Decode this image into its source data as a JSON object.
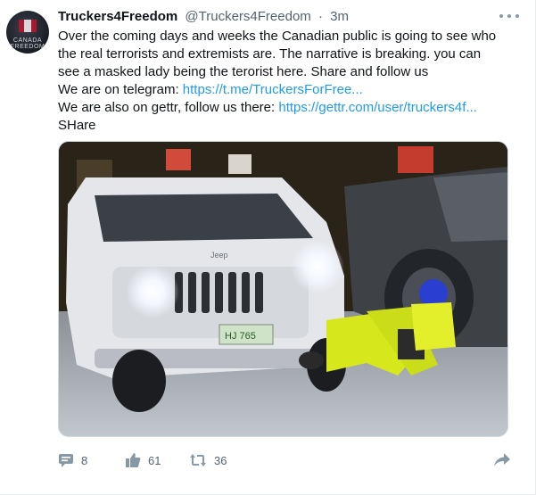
{
  "tweet": {
    "author_name": "Truckers4Freedom",
    "author_handle": "@Truckers4Freedom",
    "separator": "·",
    "time": "3m",
    "avatar_text": "CANADA FREEDOM",
    "text_lines": [
      {
        "plain": "Over the coming days and weeks the Canadian public is going to see who",
        "link": ""
      },
      {
        "plain": "the real terrorists and extremists are. The narrative is breaking. you can",
        "link": ""
      },
      {
        "plain": "see a masked lady being the terorist here. Share and follow us",
        "link": ""
      },
      {
        "plain": "We are on telegram: ",
        "link": "https://t.me/TruckersForFree..."
      },
      {
        "plain": "We are also on gettr, follow us there: ",
        "link": "https://gettr.com/user/truckers4f..."
      },
      {
        "plain": "SHare",
        "link": ""
      }
    ],
    "media": {
      "plate_text": "HJ 765",
      "jeep_badge": "Jeep"
    },
    "actions": {
      "reply_count": "8",
      "like_count": "61",
      "retweet_count": "36"
    }
  },
  "colors": {
    "link": "#1d9bf0",
    "icon": "#8899a6",
    "muted_text": "#536471"
  },
  "icons": [
    "more-icon",
    "reply-icon",
    "like-icon",
    "retweet-icon",
    "share-icon"
  ]
}
